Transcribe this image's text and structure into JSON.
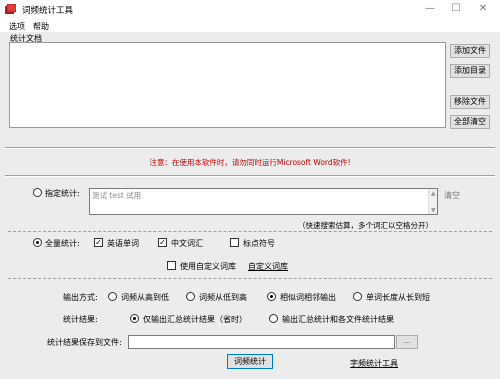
{
  "window": {
    "title": "词频统计工具",
    "minimize": "—",
    "maximize": "☐",
    "close": "✕"
  },
  "menu": {
    "items": [
      "选项",
      "帮助"
    ]
  },
  "doc_section": {
    "label": "统计文档",
    "buttons": {
      "add_file": "添加文件",
      "add_dir": "添加目录",
      "remove_file": "移除文件",
      "clear_all": "全部清空"
    }
  },
  "notice": "注意：在使用本软件时，请勿同时运行Microsoft Word软件!",
  "specified": {
    "label": "指定统计:",
    "text_value": "测试 test 试用",
    "clear_link": "清空",
    "hint": "（快速搜索估算，多个词汇以空格分开）"
  },
  "full": {
    "label": "全量统计:",
    "options": [
      {
        "label": "英语单词",
        "checked": true
      },
      {
        "label": "中文词汇",
        "checked": true
      },
      {
        "label": "标点符号",
        "checked": false
      }
    ],
    "custom_dict_label": "使用自定义词库",
    "custom_dict_checked": false,
    "custom_dict_link": "自定义词库"
  },
  "output": {
    "mode_label": "输出方式:",
    "modes": [
      {
        "label": "词频从高到低",
        "selected": false
      },
      {
        "label": "词频从低到高",
        "selected": false
      },
      {
        "label": "相似词相邻输出",
        "selected": true
      },
      {
        "label": "单词长度从长到短",
        "selected": false
      }
    ],
    "result_label": "统计结果:",
    "results": [
      {
        "label": "仅输出汇总统计结果（省时）",
        "selected": true
      },
      {
        "label": "输出汇总统计和各文件统计结果",
        "selected": false
      }
    ],
    "save_label": "统计结果保存到文件:",
    "save_path": "",
    "browse": "..."
  },
  "footer": {
    "run_button": "词频统计",
    "link": "字频统计工具"
  },
  "colors": {
    "notice": "#c00000",
    "accent": "#0078d7"
  }
}
